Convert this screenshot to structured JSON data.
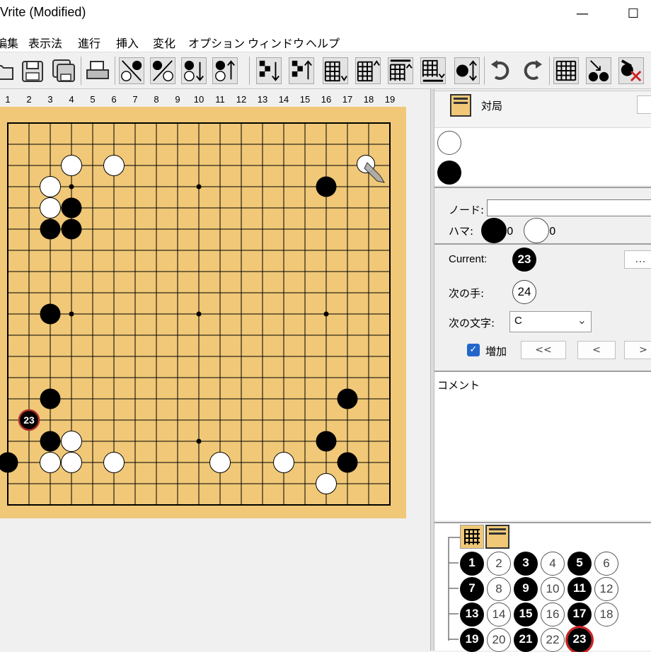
{
  "window": {
    "title": "Vrite (Modified)",
    "minimize_glyph": "—",
    "maximize_glyph": "☐"
  },
  "menu": [
    {
      "label": "編集"
    },
    {
      "label": "表示法"
    },
    {
      "label": "進行"
    },
    {
      "label": "挿入"
    },
    {
      "label": "変化"
    },
    {
      "label": "オプション"
    },
    {
      "label": "ウィンドウ"
    },
    {
      "label": "ヘルプ"
    }
  ],
  "toolbar": {
    "icons": [
      "open-icon",
      "save-icon",
      "save-as-icon",
      "print-icon",
      "number-mode-icon",
      "number-mode-alt-icon",
      "number-down-icon",
      "number-up-icon",
      "pattern-down-icon",
      "pattern-up-icon",
      "grid-down-icon",
      "grid-up-icon",
      "grid-top-icon",
      "grid-bottom-icon",
      "swap-order-icon",
      "undo-icon",
      "redo-icon",
      "board-grid-icon",
      "number-stones-icon",
      "erase-stones-icon"
    ]
  },
  "board": {
    "size": 19,
    "column_labels": [
      "1",
      "2",
      "3",
      "4",
      "5",
      "6",
      "7",
      "8",
      "9",
      "10",
      "11",
      "12",
      "13",
      "14",
      "15",
      "16",
      "17",
      "18",
      "19"
    ],
    "star_points": [
      [
        4,
        4
      ],
      [
        10,
        4
      ],
      [
        16,
        4
      ],
      [
        4,
        10
      ],
      [
        10,
        10
      ],
      [
        16,
        10
      ],
      [
        4,
        16
      ],
      [
        10,
        16
      ],
      [
        16,
        16
      ]
    ],
    "stones": [
      {
        "color": "white",
        "x": 4,
        "y": 3
      },
      {
        "color": "white",
        "x": 6,
        "y": 3
      },
      {
        "color": "white",
        "x": 3,
        "y": 4
      },
      {
        "color": "white",
        "x": 3,
        "y": 5
      },
      {
        "color": "black",
        "x": 4,
        "y": 5
      },
      {
        "color": "black",
        "x": 3,
        "y": 6
      },
      {
        "color": "black",
        "x": 4,
        "y": 6
      },
      {
        "color": "black",
        "x": 16,
        "y": 4
      },
      {
        "color": "black",
        "x": 3,
        "y": 10
      },
      {
        "color": "black",
        "x": 3,
        "y": 14
      },
      {
        "color": "black",
        "x": 17,
        "y": 14
      },
      {
        "color": "black",
        "x": 3,
        "y": 16
      },
      {
        "color": "white",
        "x": 4,
        "y": 16
      },
      {
        "color": "black",
        "x": 16,
        "y": 16
      },
      {
        "color": "black",
        "x": 1,
        "y": 17
      },
      {
        "color": "white",
        "x": 3,
        "y": 17
      },
      {
        "color": "white",
        "x": 4,
        "y": 17
      },
      {
        "color": "white",
        "x": 6,
        "y": 17
      },
      {
        "color": "white",
        "x": 11,
        "y": 17
      },
      {
        "color": "white",
        "x": 14,
        "y": 17
      },
      {
        "color": "black",
        "x": 17,
        "y": 17
      },
      {
        "color": "white",
        "x": 16,
        "y": 18
      }
    ],
    "last_move": {
      "color": "black",
      "x": 2,
      "y": 15,
      "number": "23"
    },
    "cursor_stone": {
      "color": "white",
      "x": 18,
      "y": 3
    }
  },
  "game_panel": {
    "title": "対局",
    "player_white": "",
    "player_black": ""
  },
  "node_panel": {
    "node_label": "ノード:",
    "node_value": "",
    "prisoners_label": "ハマ:",
    "black_prisoners": "0",
    "white_prisoners": "0"
  },
  "nav_panel": {
    "current_label": "Current:",
    "current_move": "23",
    "next_move_label": "次の手:",
    "next_move": "24",
    "next_char_label": "次の文字:",
    "next_char_value": "C",
    "increment_label": "増加",
    "increment_checked": true,
    "first_button": "<<",
    "prev_button": "<",
    "next_button": ">",
    "extra_button": "..."
  },
  "comment_panel": {
    "label": "コメント",
    "text": ""
  },
  "game_tree": {
    "current": "23",
    "moves": [
      {
        "n": "1",
        "color": "black"
      },
      {
        "n": "2",
        "color": "white"
      },
      {
        "n": "3",
        "color": "black"
      },
      {
        "n": "4",
        "color": "white"
      },
      {
        "n": "5",
        "color": "black"
      },
      {
        "n": "6",
        "color": "white"
      },
      {
        "n": "7",
        "color": "black"
      },
      {
        "n": "8",
        "color": "white"
      },
      {
        "n": "9",
        "color": "black"
      },
      {
        "n": "10",
        "color": "white"
      },
      {
        "n": "11",
        "color": "black"
      },
      {
        "n": "12",
        "color": "white"
      },
      {
        "n": "13",
        "color": "black"
      },
      {
        "n": "14",
        "color": "white"
      },
      {
        "n": "15",
        "color": "black"
      },
      {
        "n": "16",
        "color": "white"
      },
      {
        "n": "17",
        "color": "black"
      },
      {
        "n": "18",
        "color": "white"
      },
      {
        "n": "19",
        "color": "black"
      },
      {
        "n": "20",
        "color": "white"
      },
      {
        "n": "21",
        "color": "black"
      },
      {
        "n": "22",
        "color": "white"
      },
      {
        "n": "23",
        "color": "black"
      }
    ]
  }
}
